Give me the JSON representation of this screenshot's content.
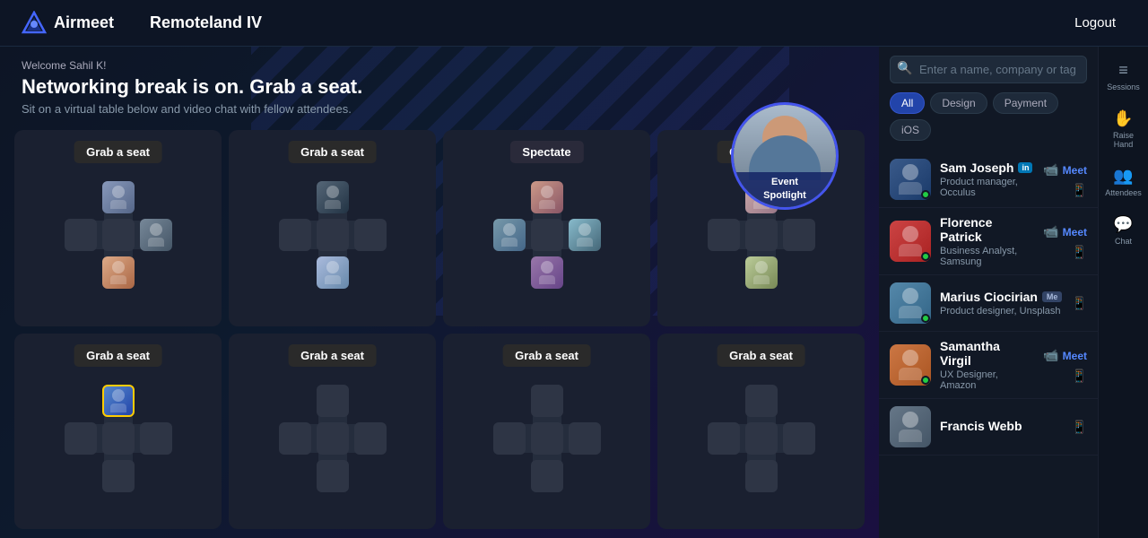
{
  "header": {
    "logo_text": "Airmeet",
    "event_title": "Remoteland IV",
    "logout_label": "Logout"
  },
  "banner": {
    "welcome": "Welcome Sahil K!",
    "headline": "Networking break is on. Grab a seat.",
    "subtext": "Sit on a virtual table below and video chat with fellow attendees."
  },
  "spotlight": {
    "label_line1": "Event",
    "label_line2": "Spotlight"
  },
  "tables": [
    {
      "id": "t1",
      "btn_label": "Grab a seat",
      "btn_type": "grab",
      "seats": {
        "top": "f1",
        "left": "empty",
        "right": "m1",
        "bottom": "f3"
      }
    },
    {
      "id": "t2",
      "btn_label": "Grab a seat",
      "btn_type": "grab",
      "seats": {
        "top": "m2",
        "left": "empty",
        "right": "empty",
        "bottom": "f5"
      }
    },
    {
      "id": "t3",
      "btn_label": "Spectate",
      "btn_type": "spectate",
      "seats": {
        "top": "f2",
        "left": "m3",
        "right": "f4",
        "bottom": "m4"
      }
    },
    {
      "id": "t4",
      "btn_label": "Grab a seat",
      "btn_type": "grab",
      "seats": {
        "top": "f6",
        "left": "empty",
        "right": "empty",
        "bottom": "f7"
      }
    },
    {
      "id": "t5",
      "btn_label": "Grab a seat",
      "btn_type": "grab",
      "seats": {
        "top": "me",
        "left": "empty",
        "right": "empty",
        "bottom": "empty"
      }
    },
    {
      "id": "t6",
      "btn_label": "Grab a seat",
      "btn_type": "grab",
      "seats": {
        "top": "empty",
        "left": "empty",
        "right": "empty",
        "bottom": "empty"
      }
    },
    {
      "id": "t7",
      "btn_label": "Grab a seat",
      "btn_type": "grab",
      "seats": {
        "top": "empty",
        "left": "empty",
        "right": "empty",
        "bottom": "empty"
      }
    },
    {
      "id": "t8",
      "btn_label": "Grab a seat",
      "btn_type": "grab",
      "seats": {
        "top": "empty",
        "left": "empty",
        "right": "empty",
        "bottom": "empty"
      }
    }
  ],
  "sidebar": {
    "search_placeholder": "Enter a name, company or tag",
    "tags": [
      {
        "label": "All",
        "active": true
      },
      {
        "label": "Design",
        "active": false
      },
      {
        "label": "Payment",
        "active": false
      },
      {
        "label": "iOS",
        "active": false
      }
    ],
    "icons": [
      {
        "label": "Sessions",
        "symbol": "≡"
      },
      {
        "label": "Raise Hand",
        "symbol": "✋"
      },
      {
        "label": "Attendees",
        "symbol": "👥"
      },
      {
        "label": "Chat",
        "symbol": "💬"
      }
    ],
    "attendees": [
      {
        "name": "Sam Joseph",
        "role": "Product manager, Occulus",
        "online": true,
        "has_linkedin": true,
        "has_meet": true,
        "avatar_color": "#3a5a8a",
        "avatar_color2": "#1a3a6a"
      },
      {
        "name": "Florence Patrick",
        "role": "Business Analyst, Samsung",
        "online": true,
        "has_linkedin": false,
        "has_meet": true,
        "avatar_color": "#cc4444",
        "avatar_color2": "#aa2222"
      },
      {
        "name": "Marius Ciocirian",
        "role": "Product designer, Unsplash",
        "online": true,
        "has_linkedin": false,
        "is_me": true,
        "has_meet": false,
        "avatar_color": "#5588aa",
        "avatar_color2": "#336688"
      },
      {
        "name": "Samantha Virgil",
        "role": "UX Designer, Amazon",
        "online": true,
        "has_linkedin": false,
        "has_meet": true,
        "avatar_color": "#cc7744",
        "avatar_color2": "#aa5522"
      },
      {
        "name": "Francis Webb",
        "role": "",
        "online": false,
        "has_linkedin": false,
        "has_meet": false,
        "avatar_color": "#667788",
        "avatar_color2": "#445566"
      }
    ],
    "meet_label": "Meet"
  }
}
